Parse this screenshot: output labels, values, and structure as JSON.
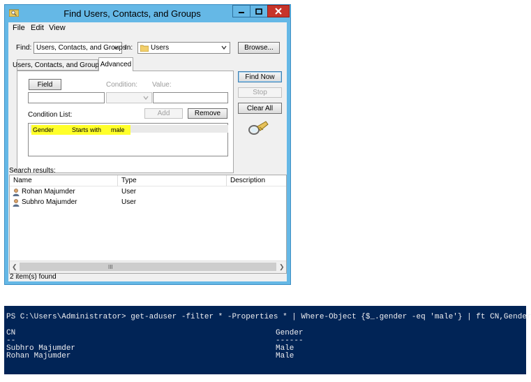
{
  "window": {
    "title": "Find Users, Contacts, and Groups",
    "menu": [
      "File",
      "Edit",
      "View"
    ]
  },
  "find_row": {
    "find_label": "Find:",
    "find_value": "Users, Contacts, and Groups",
    "in_label": "In:",
    "in_value": "Users",
    "browse_button": "Browse..."
  },
  "tabs": [
    "Users, Contacts, and Groups",
    "Advanced"
  ],
  "advanced": {
    "field_button": "Field",
    "condition_label": "Condition:",
    "value_label": "Value:",
    "add_button": "Add",
    "remove_button": "Remove",
    "condition_list_label": "Condition List:",
    "conditions": [
      {
        "field": "Gender",
        "condition": "Starts with",
        "value": "male"
      }
    ]
  },
  "side_buttons": {
    "find_now": "Find Now",
    "stop": "Stop",
    "clear_all": "Clear All"
  },
  "results": {
    "label": "Search results:",
    "columns": [
      "Name",
      "Type",
      "Description"
    ],
    "rows": [
      {
        "name": "Rohan Majumder",
        "type": "User",
        "description": ""
      },
      {
        "name": "Subhro Majumder",
        "type": "User",
        "description": ""
      }
    ],
    "scroll_grip": "III"
  },
  "status": "2 item(s) found",
  "powershell": {
    "command": "PS C:\\Users\\Administrator> get-aduser -filter * -Properties * | Where-Object {$_.gender -eq 'male'} | ft CN,Gender",
    "columns": [
      "CN",
      "Gender"
    ],
    "separators": [
      "--",
      "------"
    ],
    "rows": [
      {
        "cn": "Subhro Majumder",
        "gender": "Male"
      },
      {
        "cn": "Rohan Majumder",
        "gender": "Male"
      }
    ]
  },
  "colors": {
    "title_bar": "#65b8e6",
    "close_button": "#c7342a",
    "highlight": "#ffff2a",
    "console_bg": "#012456",
    "console_fg": "#eeedf0"
  }
}
